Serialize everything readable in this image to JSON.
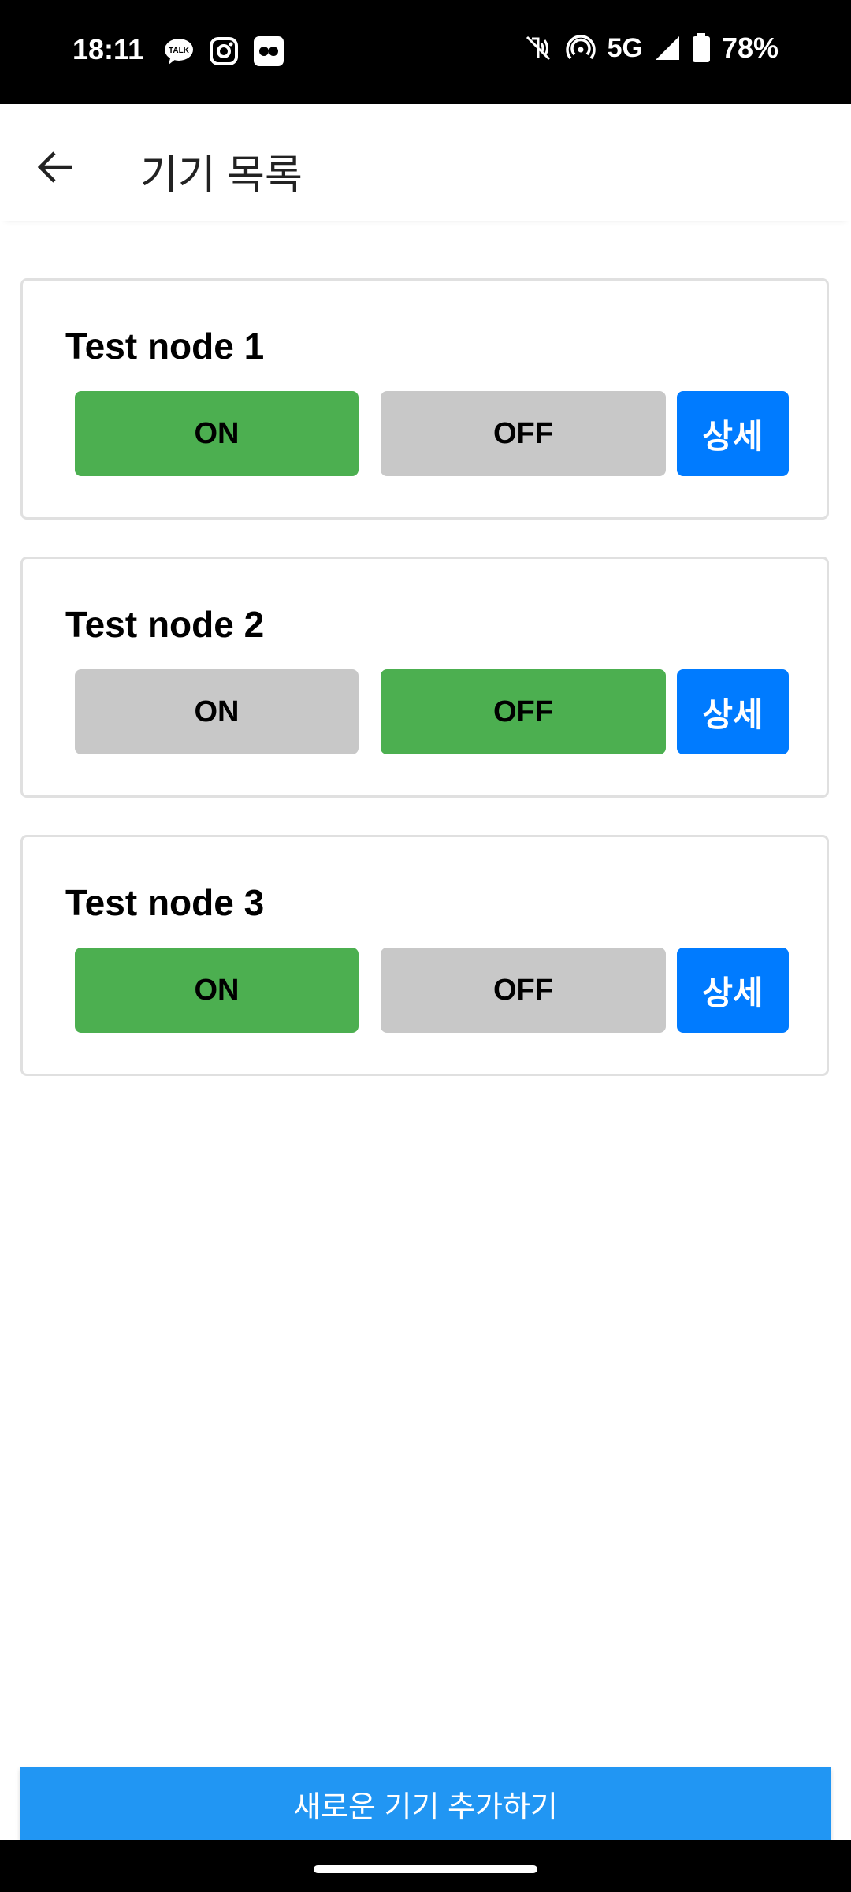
{
  "status_bar": {
    "time": "18:11",
    "left_icons": [
      "kakaotalk-icon",
      "instagram-icon",
      "flickr-icon"
    ],
    "network": "5G",
    "battery": "78%"
  },
  "header": {
    "title": "기기 목록",
    "back_icon": "arrow-left-icon"
  },
  "devices": [
    {
      "name": "Test node 1",
      "on_label": "ON",
      "off_label": "OFF",
      "detail_label": "상세",
      "state": "on"
    },
    {
      "name": "Test node 2",
      "on_label": "ON",
      "off_label": "OFF",
      "detail_label": "상세",
      "state": "off"
    },
    {
      "name": "Test node 3",
      "on_label": "ON",
      "off_label": "OFF",
      "detail_label": "상세",
      "state": "on"
    }
  ],
  "footer": {
    "add_button_label": "새로운 기기 추가하기"
  },
  "colors": {
    "active": "#4caf50",
    "inactive": "#c8c8c8",
    "detail": "#007bff",
    "add_button": "#2196f3"
  }
}
